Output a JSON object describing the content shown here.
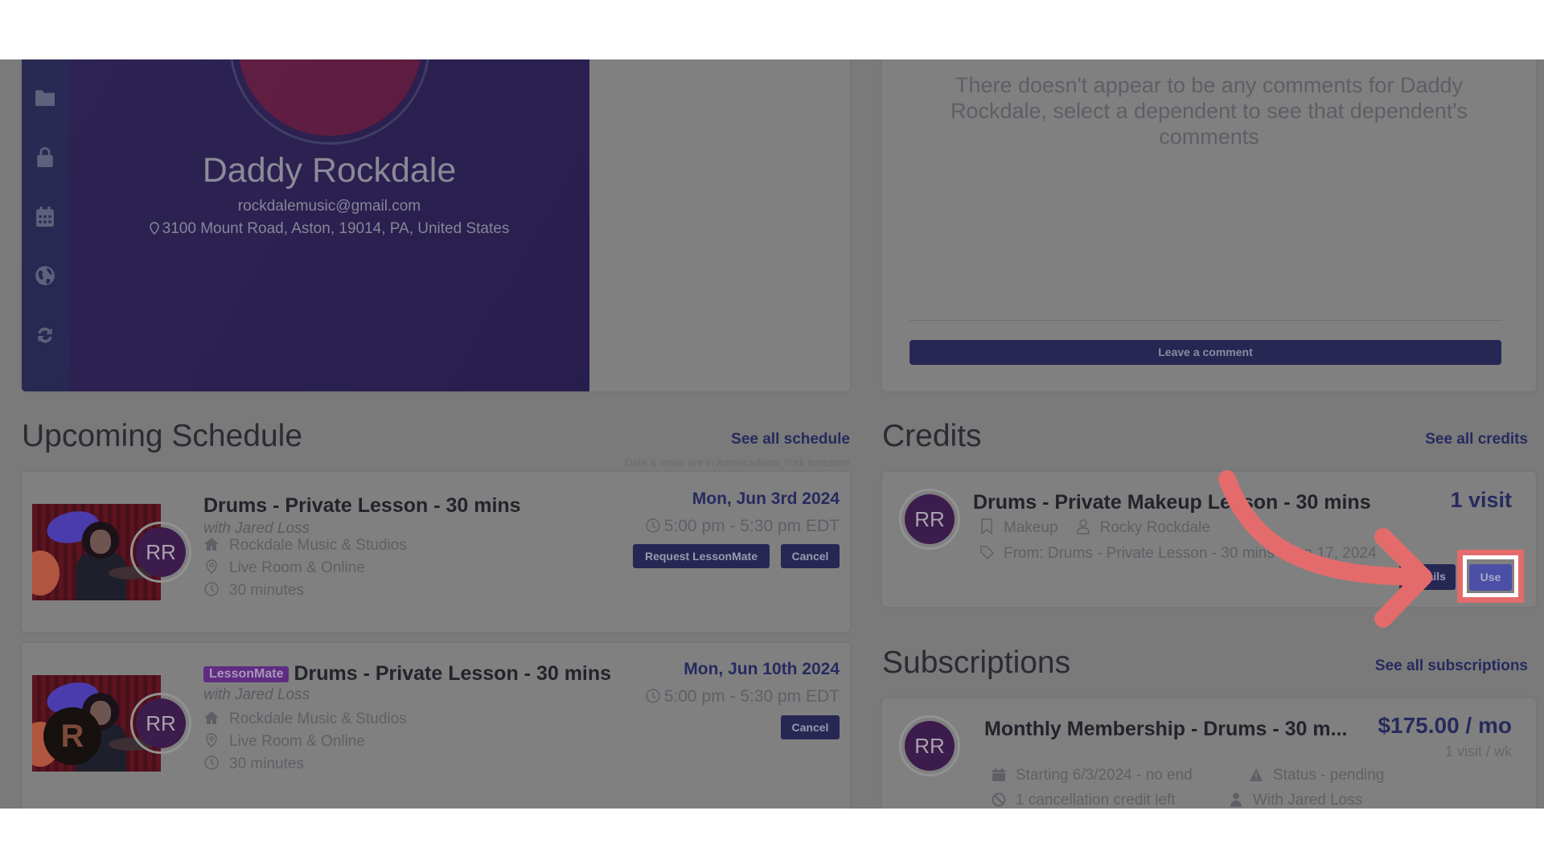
{
  "profile": {
    "name": "Daddy Rockdale",
    "email": "rockdalemusic@gmail.com",
    "address": "3100 Mount Road, Aston, 19014, PA, United States",
    "sidebar_icons": [
      "user-icon",
      "folder-icon",
      "lock-icon",
      "calendar-icon",
      "globe-icon",
      "refresh-icon"
    ]
  },
  "comments": {
    "empty_message": "There doesn't appear to be any comments for Daddy Rockdale, select a dependent to see that dependent's comments",
    "leave_comment_label": "Leave a comment"
  },
  "schedule": {
    "title": "Upcoming Schedule",
    "see_all_label": "See all schedule",
    "timezone_note": "Date & times are in America/New_York timezone",
    "items": [
      {
        "badge": "",
        "title": "Drums - Private Lesson - 30 mins",
        "with": "with Jared Loss",
        "location": "Rockdale Music & Studios",
        "room": "Live Room & Online",
        "duration": "30 minutes",
        "date": "Mon, Jun 3rd 2024",
        "time": "5:00 pm - 5:30 pm EDT",
        "avatar_initials": "RR",
        "request_label": "Request LessonMate",
        "cancel_label": "Cancel"
      },
      {
        "badge": "LessonMate",
        "title": "Drums - Private Lesson - 30 mins",
        "with": "with Jared Loss",
        "location": "Rockdale Music & Studios",
        "room": "Live Room & Online",
        "duration": "30 minutes",
        "date": "Mon, Jun 10th 2024",
        "time": "5:00 pm - 5:30 pm EDT",
        "avatar_initials": "RR",
        "logo_letter": "R",
        "cancel_label": "Cancel"
      }
    ]
  },
  "credits": {
    "title": "Credits",
    "see_all_label": "See all credits",
    "item": {
      "avatar_initials": "RR",
      "title": "Drums - Private Makeup Lesson - 30 mins",
      "type": "Makeup",
      "student": "Rocky Rockdale",
      "from": "From: Drums - Private Lesson - 30 mins - Jun 17, 2024",
      "visits": "1 visit",
      "details_label": "Details",
      "use_label": "Use"
    }
  },
  "subscriptions": {
    "title": "Subscriptions",
    "see_all_label": "See all subscriptions",
    "item": {
      "avatar_initials": "RR",
      "title": "Monthly Membership - Drums - 30 m...",
      "price": "$175.00 / mo",
      "rate": "1 visit / wk",
      "starting": "Starting 6/3/2024 - no end",
      "status": "Status - pending",
      "cancellation": "1 cancellation credit left",
      "teacher": "With Jared Loss"
    }
  },
  "annotation": {
    "color": "#e46b6b",
    "target": "use-button"
  }
}
